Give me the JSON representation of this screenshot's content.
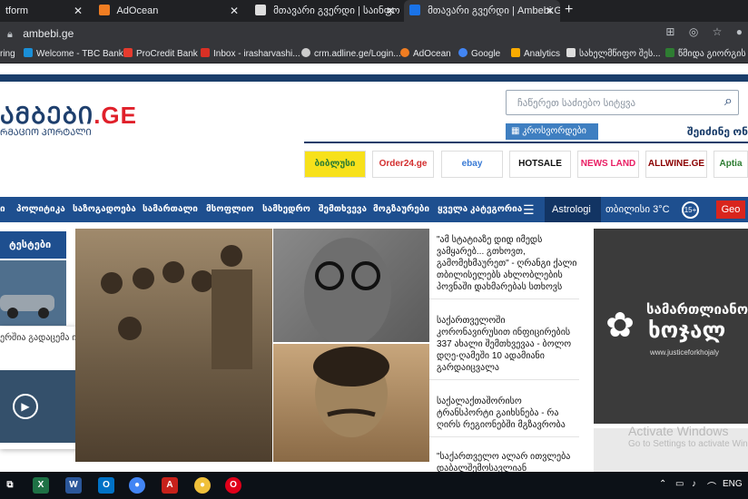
{
  "tabs": [
    {
      "label": "tform",
      "active": false
    },
    {
      "label": "AdOcean",
      "active": false
    },
    {
      "label": "მთავარი გვერდი | საინფორმ",
      "active": false
    },
    {
      "label": "მთავარი გვერდი | Ambebi.GE",
      "active": true
    }
  ],
  "address": {
    "url": "ambebi.ge"
  },
  "bookmarks": [
    "ring",
    "Welcome - TBC Bank",
    "ProCredit Bank",
    "Inbox - irasharvashi...",
    "crm.adline.ge/Login...",
    "AdOcean",
    "Google",
    "Analytics",
    "სახელმწიფო შეს...",
    "წმიდა გიორგის ს"
  ],
  "site": {
    "logo_main": "ᲐᲛᲑᲔᲑᲘ",
    "logo_ge": ".GE",
    "tagline": "ᲠᲛᲐᲪᲘᲝ ᲞᲝᲠᲢᲐᲚᲘ",
    "search_placeholder": "ჩაწერეთ საძიებო სიტყვა",
    "crossword": "კროსვორდები",
    "login": "შეიძინე ონ"
  },
  "partners": [
    "ბიბლუსი",
    "Order24.ge",
    "ebay",
    "HOTSALE",
    "NEWS LAND",
    "ALLWINE.GE",
    "Aptia"
  ],
  "nav": {
    "items": [
      "ი",
      "პოლიტიკა",
      "საზოგადოება",
      "სამართალი",
      "მსოფლიო",
      "სამხედრო",
      "შემთხვევა",
      "მოგზაურები",
      "ყველა კატეგორია"
    ],
    "astro": "Astrologi",
    "weather": "თბილისი 3°C",
    "age": "15+",
    "lang": "Geo"
  },
  "tests": "ტესტები",
  "popup": {
    "text": "ერშია გადაცემა ი-ი"
  },
  "news": [
    "\"ამ სტატიაზე დიდ იმედს ვამყარებ... გთხოვთ, გამომეხმაურეთ\" - ღრანგი ქალი თბილისელებს ახლობლების პოვნაში დახმარებას სთხოვს",
    "საქართველოში კორონავირუსით ინფიცირების 337 ახალი შემთხვევაა - ბოლო დღე-ღამეში 10 ადამიანი გარდაიცვალა",
    "საქალაქთაშორისო ტრანსპორტი გაიხსნება - რა ღირს რეგიონებში მგზავრობა",
    "\"საქართველო ალარ ითვლება დაბალშემოსავლიან"
  ],
  "ad": {
    "line1": "სამართლიანო",
    "line2": "ხოჯალ",
    "line3": "www.justiceforkhojaly"
  },
  "watermark": {
    "line1": "Activate Windows",
    "line2": "Go to Settings to activate Win"
  },
  "taskbar": {
    "lang": "ENG"
  }
}
